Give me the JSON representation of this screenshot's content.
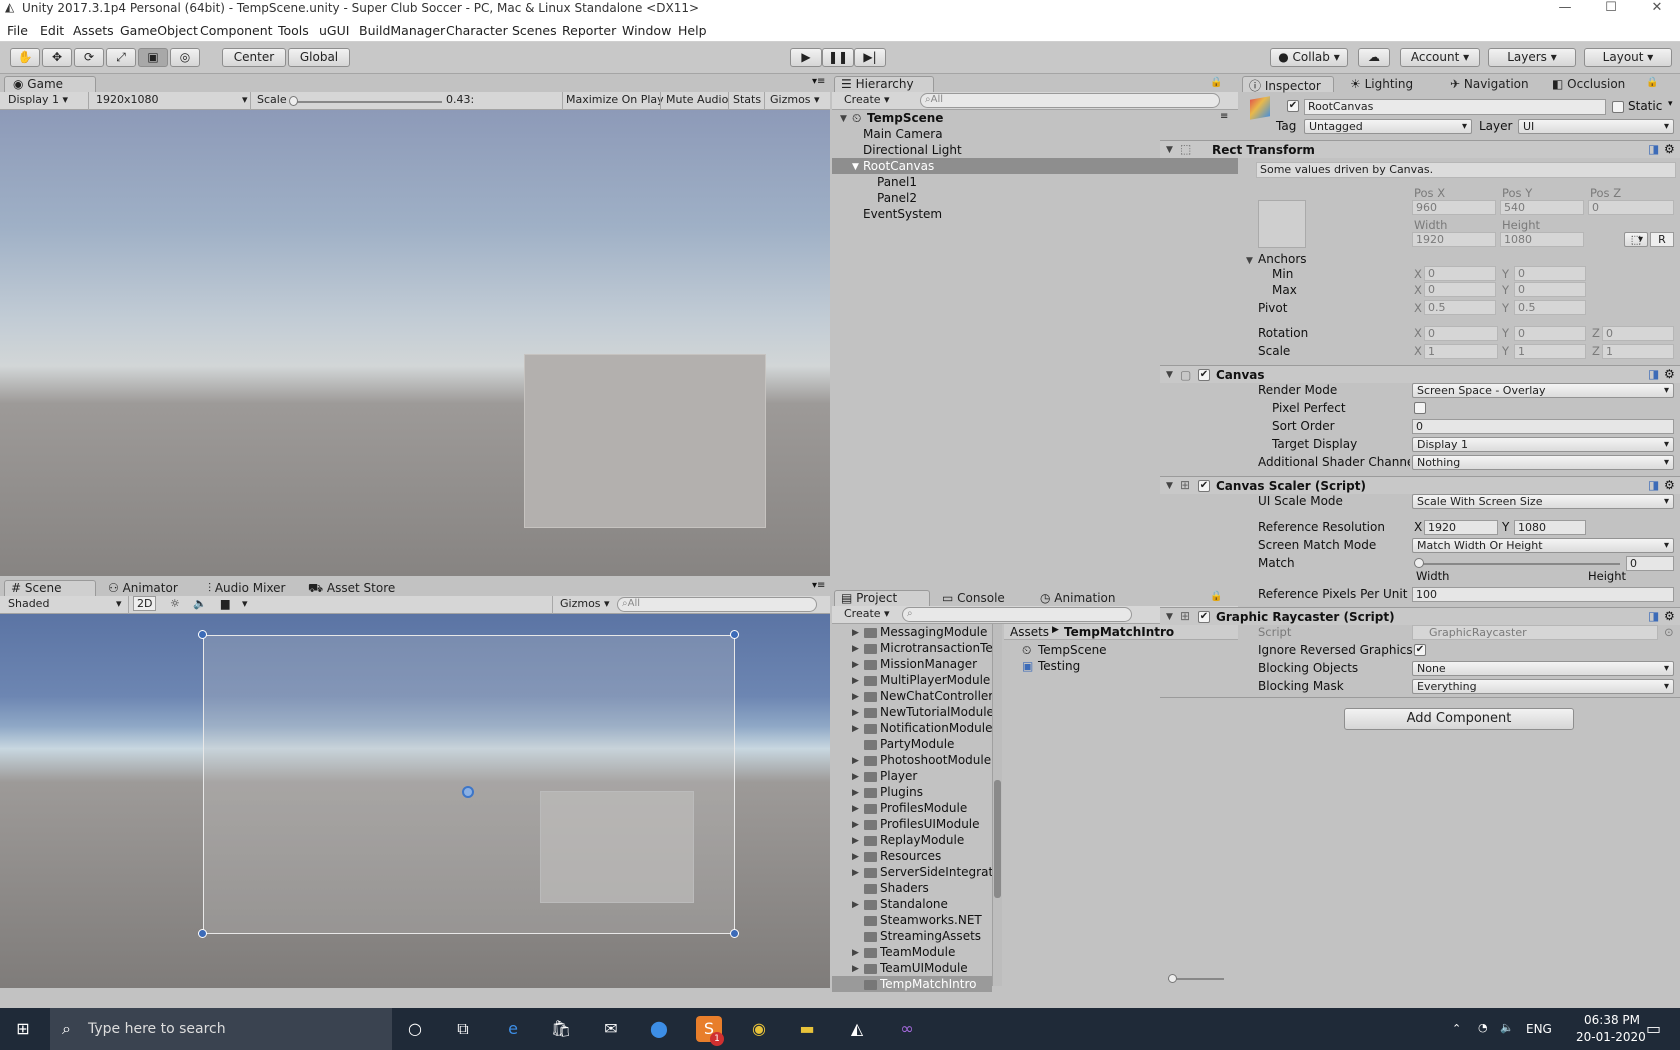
{
  "window": {
    "title": "Unity 2017.3.1p4 Personal (64bit) - TempScene.unity - Super Club Soccer - PC, Mac & Linux Standalone <DX11>",
    "controls": [
      "—",
      "☐",
      "✕"
    ]
  },
  "menu": [
    "File",
    "Edit",
    "Assets",
    "GameObject",
    "Component",
    "Tools",
    "uGUI",
    "BuildManager",
    "Character",
    "Scenes",
    "Reporter",
    "Window",
    "Help"
  ],
  "toolbar": {
    "pivot": "Center",
    "space": "Global",
    "collab": "Collab",
    "account": "Account",
    "layers": "Layers",
    "layout": "Layout"
  },
  "game": {
    "tab": "Game",
    "display": "Display 1",
    "resolution": "1920x1080",
    "scale_label": "Scale",
    "scale_value": "0.43:",
    "maximize": "Maximize On Play",
    "mute": "Mute Audio",
    "stats": "Stats",
    "gizmos": "Gizmos"
  },
  "scene": {
    "tabs": [
      "Scene",
      "Animator",
      "Audio Mixer",
      "Asset Store"
    ],
    "shading": "Shaded",
    "mode2d": "2D",
    "gizmos": "Gizmos",
    "search_placeholder": "All"
  },
  "hierarchy": {
    "tab": "Hierarchy",
    "create": "Create",
    "search_placeholder": "All",
    "scene": "TempScene",
    "items": [
      {
        "label": "Main Camera",
        "indent": 0
      },
      {
        "label": "Directional Light",
        "indent": 0
      },
      {
        "label": "RootCanvas",
        "indent": 0,
        "selected": true
      },
      {
        "label": "Panel1",
        "indent": 1
      },
      {
        "label": "Panel2",
        "indent": 1
      },
      {
        "label": "EventSystem",
        "indent": 0
      }
    ]
  },
  "project": {
    "tabs": [
      "Project",
      "Console",
      "Animation"
    ],
    "create": "Create",
    "folders": [
      "MessagingModule",
      "MicrotransactionTe",
      "MissionManager",
      "MultiPlayerModule",
      "NewChatController",
      "NewTutorialModule",
      "NotificationModule",
      "PartyModule",
      "PhotoshootModule",
      "Player",
      "Plugins",
      "ProfilesModule",
      "ProfilesUIModule",
      "ReplayModule",
      "Resources",
      "ServerSideIntegrat",
      "Shaders",
      "Standalone",
      "Steamworks.NET",
      "StreamingAssets",
      "TeamModule",
      "TeamUIModule",
      "TempMatchIntro"
    ],
    "breadcrumb_root": "Assets",
    "breadcrumb_current": "TempMatchIntro",
    "assets": [
      "TempScene",
      "Testing"
    ]
  },
  "inspector": {
    "tabs": [
      "Inspector",
      "Lighting",
      "Navigation",
      "Occlusion"
    ],
    "object_name": "RootCanvas",
    "static_label": "Static",
    "tag_label": "Tag",
    "tag_value": "Untagged",
    "layer_label": "Layer",
    "layer_value": "UI",
    "rect": {
      "title": "Rect Transform",
      "note": "Some values driven by Canvas.",
      "posx_label": "Pos X",
      "posx": "960",
      "posy_label": "Pos Y",
      "posy": "540",
      "posz_label": "Pos Z",
      "posz": "0",
      "width_label": "Width",
      "width": "1920",
      "height_label": "Height",
      "height": "1080",
      "r_btn": "R",
      "anchors": "Anchors",
      "min": "Min",
      "min_x": "0",
      "min_y": "0",
      "max": "Max",
      "max_x": "0",
      "max_y": "0",
      "pivot": "Pivot",
      "pivot_x": "0.5",
      "pivot_y": "0.5",
      "rotation": "Rotation",
      "rot_x": "0",
      "rot_y": "0",
      "rot_z": "0",
      "scale": "Scale",
      "scale_x": "1",
      "scale_y": "1",
      "scale_z": "1",
      "x": "X",
      "y": "Y",
      "z": "Z"
    },
    "canvas": {
      "title": "Canvas",
      "render_mode_label": "Render Mode",
      "render_mode": "Screen Space - Overlay",
      "pixel_perfect_label": "Pixel Perfect",
      "sort_order_label": "Sort Order",
      "sort_order": "0",
      "target_display_label": "Target Display",
      "target_display": "Display 1",
      "shader_channels_label": "Additional Shader Channels",
      "shader_channels": "Nothing"
    },
    "scaler": {
      "title": "Canvas Scaler (Script)",
      "ui_scale_mode_label": "UI Scale Mode",
      "ui_scale_mode": "Scale With Screen Size",
      "ref_res_label": "Reference Resolution",
      "ref_x": "1920",
      "ref_y": "1080",
      "match_mode_label": "Screen Match Mode",
      "match_mode": "Match Width Or Height",
      "match_label": "Match",
      "match_value": "0",
      "match_fraction": 0,
      "width_label": "Width",
      "height_label": "Height",
      "ref_ppu_label": "Reference Pixels Per Unit",
      "ref_ppu": "100"
    },
    "raycaster": {
      "title": "Graphic Raycaster (Script)",
      "script_label": "Script",
      "script_value": "GraphicRaycaster",
      "ignore_label": "Ignore Reversed Graphics",
      "blocking_objects_label": "Blocking Objects",
      "blocking_objects": "None",
      "blocking_mask_label": "Blocking Mask",
      "blocking_mask": "Everything"
    },
    "add_component": "Add Component"
  },
  "taskbar": {
    "search_placeholder": "Type here to search",
    "lang": "ENG",
    "time": "06:38 PM",
    "date": "20-01-2020",
    "skype_badge": "1"
  }
}
